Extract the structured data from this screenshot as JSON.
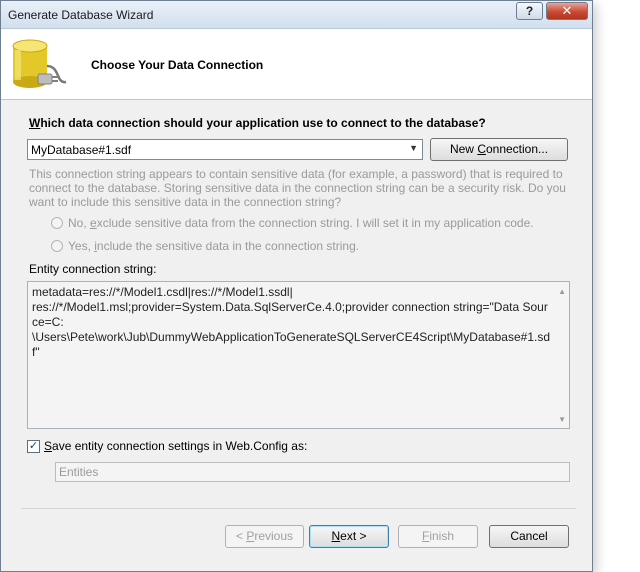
{
  "window": {
    "title": "Generate Database Wizard",
    "help_glyph": "?",
    "close_glyph": "✕"
  },
  "header": {
    "title": "Choose Your Data Connection",
    "icon": "database-plug-icon"
  },
  "question": {
    "hot": "W",
    "rest": "hich data connection should your application use to connect to the database?"
  },
  "connection": {
    "selected": "MyDatabase#1.sdf"
  },
  "new_connection": {
    "pre": "New ",
    "hot": "C",
    "post": "onnection..."
  },
  "sensitive_note": "This connection string appears to contain sensitive data (for example, a password) that is required to connect to the database. Storing sensitive data in the connection string can be a security risk. Do you want to include this sensitive data in the connection string?",
  "radio_no": {
    "pre": "No, ",
    "hot": "e",
    "post": "xclude sensitive data from the connection string. I will set it in my application code."
  },
  "radio_yes": {
    "pre": "Yes, ",
    "hot": "i",
    "post": "nclude the sensitive data in the connection string."
  },
  "entity": {
    "label": "Entity connection string:",
    "line1": "metadata=res://*/Model1.csdl|res://*/Model1.ssdl|",
    "line2": "res://*/Model1.msl;provider=System.Data.SqlServerCe.4.0;provider connection string=\"Data Source=C:",
    "line3": "\\Users\\Pete\\work\\Jub\\DummyWebApplicationToGenerateSQLServerCE4Script\\MyDatabase#1.sdf\""
  },
  "save_settings": {
    "checked": true,
    "check_glyph": "✓",
    "hot": "S",
    "rest": "ave entity connection settings in Web.Config as:"
  },
  "entities_name": "Entities",
  "buttons": {
    "previous": {
      "pre": "< ",
      "hot": "P",
      "post": "revious"
    },
    "next": {
      "pre": "",
      "hot": "N",
      "post": "ext >"
    },
    "finish": {
      "pre": "",
      "hot": "F",
      "post": "inish"
    },
    "cancel": "Cancel"
  },
  "colors": {
    "accent": "#3c7fb1",
    "disabled_text": "#9a9a9a",
    "close": "#c94a34"
  }
}
